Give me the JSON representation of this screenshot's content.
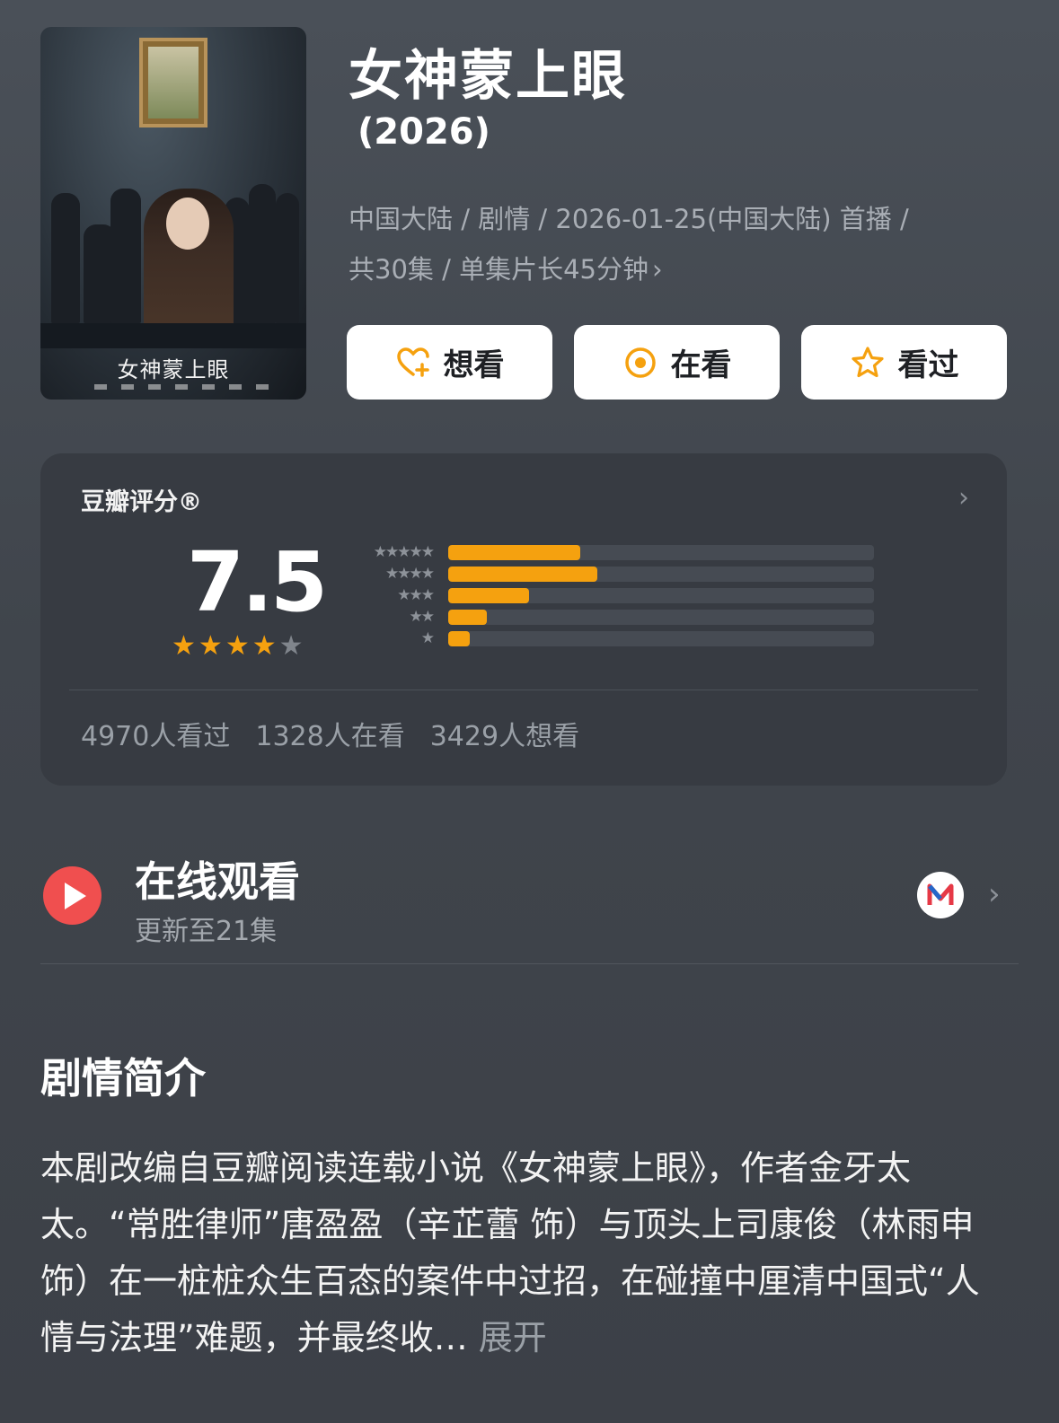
{
  "poster": {
    "title": "女神蒙上眼"
  },
  "title": "女神蒙上眼",
  "year": "(2026)",
  "meta": {
    "line1": "中国大陆 / 剧情 / 2026-01-25(中国大陆) 首播 /",
    "line2": "共30集 / 单集片长45分钟",
    "chevron": "›"
  },
  "buttons": {
    "want": "想看",
    "watching": "在看",
    "watched": "看过"
  },
  "rating": {
    "label": "豆瓣评分®",
    "score": "7.5",
    "stars_value": 4,
    "stars_max": 5,
    "distribution_percent": [
      31,
      35,
      19,
      9,
      5
    ],
    "mini_stars": [
      "★★★★★",
      "★★★★",
      "★★★",
      "★★",
      "★"
    ],
    "counts": {
      "watched": "4970人看过",
      "watching": "1328人在看",
      "want": "3429人想看"
    }
  },
  "online": {
    "title": "在线观看",
    "update": "更新至21集"
  },
  "synopsis": {
    "title": "剧情简介",
    "text": "本剧改编自豆瓣阅读连载小说《女神蒙上眼》，作者金牙太太。“常胜律师”唐盈盈（辛芷蕾 饰）与顶头上司康俊（林雨申 饰）在一桩桩众生百态的案件中过招，在碰撞中厘清中国式“人情与法理”难题，并最终收…",
    "more": "展开"
  },
  "colors": {
    "accent": "#f5a10f",
    "play": "#f04f4f"
  }
}
